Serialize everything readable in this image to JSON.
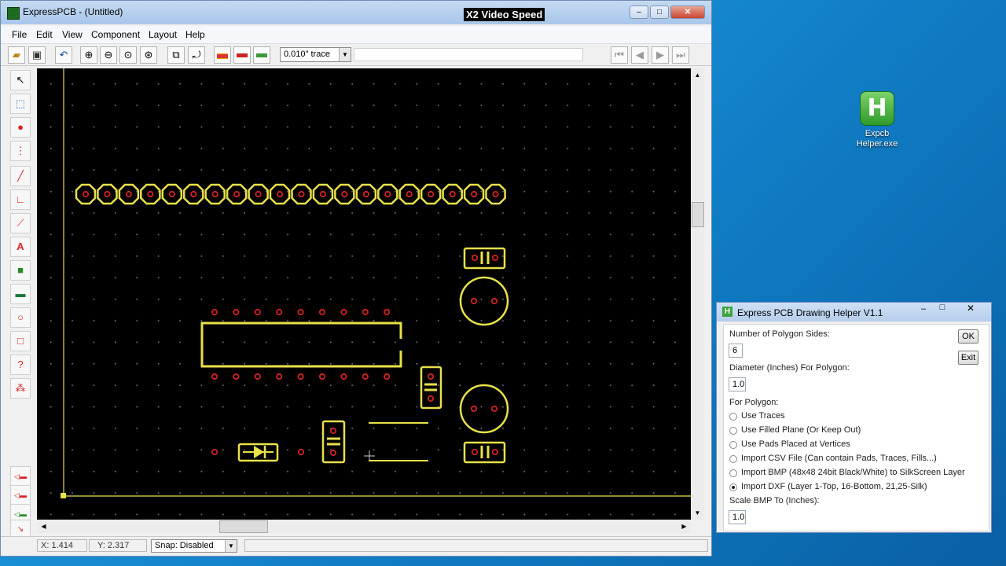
{
  "window": {
    "title": "ExpressPCB - (Untitled)",
    "overlay": "X2 Video Speed"
  },
  "menu": [
    "File",
    "Edit",
    "View",
    "Component",
    "Layout",
    "Help"
  ],
  "toolbar": {
    "trace_width": "0.010\" trace"
  },
  "status": {
    "x": "X: 1.414",
    "y": "Y: 2.317",
    "snap": "Snap:  Disabled"
  },
  "desktop": {
    "icon_label_1": "Expcb",
    "icon_label_2": "Helper.exe"
  },
  "helper": {
    "title": "Express PCB Drawing Helper V1.1",
    "sides_label": "Number of Polygon Sides:",
    "sides_value": "6",
    "diameter_label": "Diameter (Inches) For Polygon:",
    "diameter_value": "1.0",
    "for_polygon_label": "For Polygon:",
    "options": [
      "Use Traces",
      "Use Filled Plane (Or Keep Out)",
      "Use Pads Placed at Vertices",
      "Import CSV File (Can contain Pads, Traces, Fills...)",
      "Import BMP (48x48 24bit Black/White) to SilkScreen Layer",
      "Import DXF (Layer 1-Top, 16-Bottom, 21,25-Silk)"
    ],
    "selected_option": 5,
    "scale_label": "Scale BMP To (Inches):",
    "scale_value": "1.0",
    "ok_label": "OK",
    "exit_label": "Exit"
  },
  "colors": {
    "silk": "#e8e14a",
    "pad": "#d42020",
    "canvas": "#000000"
  }
}
